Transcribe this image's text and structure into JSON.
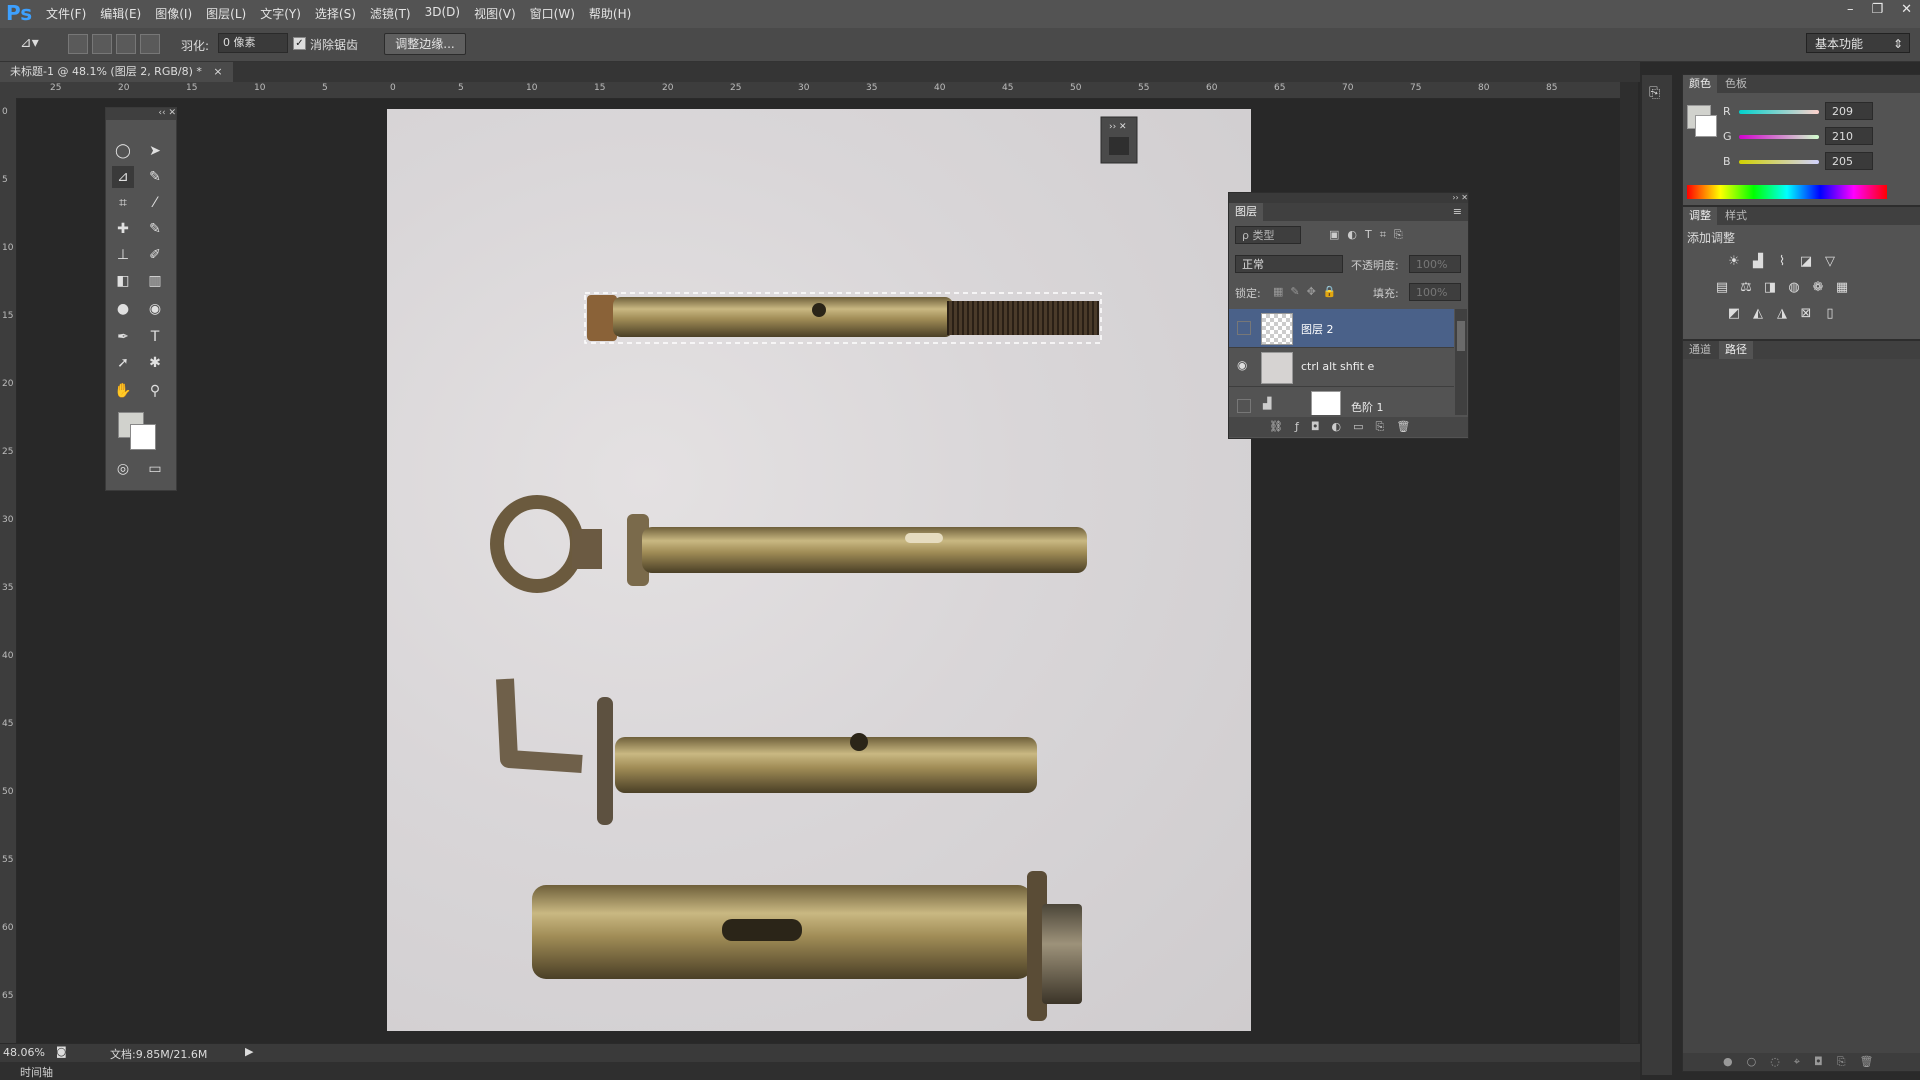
{
  "app": {
    "logo": "Ps"
  },
  "menu": [
    "文件(F)",
    "编辑(E)",
    "图像(I)",
    "图层(L)",
    "文字(Y)",
    "选择(S)",
    "滤镜(T)",
    "3D(D)",
    "视图(V)",
    "窗口(W)",
    "帮助(H)"
  ],
  "window_controls": {
    "minimize": "–",
    "restore": "❐",
    "close": "✕"
  },
  "options_bar": {
    "feather_label": "羽化:",
    "feather_value": "0 像素",
    "antialias_label": "消除锯齿",
    "antialias_checked": true,
    "refine_edge_label": "调整边缘...",
    "workspace_label": "基本功能"
  },
  "document_tab": {
    "title": "未标题-1 @ 48.1% (图层 2, RGB/8) *",
    "close": "×"
  },
  "ruler": {
    "top_labels": [
      "25",
      "20",
      "15",
      "10",
      "5",
      "0",
      "5",
      "10",
      "15",
      "20",
      "25",
      "30",
      "35",
      "40",
      "45",
      "50",
      "55",
      "60",
      "65",
      "70",
      "75",
      "80",
      "85"
    ],
    "left_labels": [
      "0",
      "5",
      "10",
      "15",
      "20",
      "25",
      "30",
      "35",
      "40",
      "45",
      "50",
      "55",
      "60",
      "65"
    ]
  },
  "status": {
    "zoom": "48.06%",
    "doc_info": "文档:9.85M/21.6M",
    "timeline_label": "时间轴"
  },
  "layers_panel": {
    "title": "图层",
    "filter_label": "ρ 类型",
    "blend_mode": "正常",
    "opacity_label": "不透明度:",
    "opacity_value": "100%",
    "lock_label": "锁定:",
    "fill_label": "填充:",
    "fill_value": "100%",
    "layers": [
      {
        "name": "图层 2",
        "visible": false,
        "selected": true
      },
      {
        "name": "ctrl alt shfit e",
        "visible": true,
        "selected": false
      },
      {
        "name": "色阶 1",
        "visible": false,
        "selected": false
      }
    ]
  },
  "color_panel": {
    "tabs": [
      "颜色",
      "色板"
    ],
    "channels": [
      {
        "label": "R",
        "value": "209"
      },
      {
        "label": "G",
        "value": "210"
      },
      {
        "label": "B",
        "value": "205"
      }
    ]
  },
  "adjustments_panel": {
    "tabs": [
      "调整",
      "样式"
    ],
    "heading": "添加调整"
  },
  "channels_panel": {
    "tabs": [
      "通道",
      "路径"
    ]
  }
}
